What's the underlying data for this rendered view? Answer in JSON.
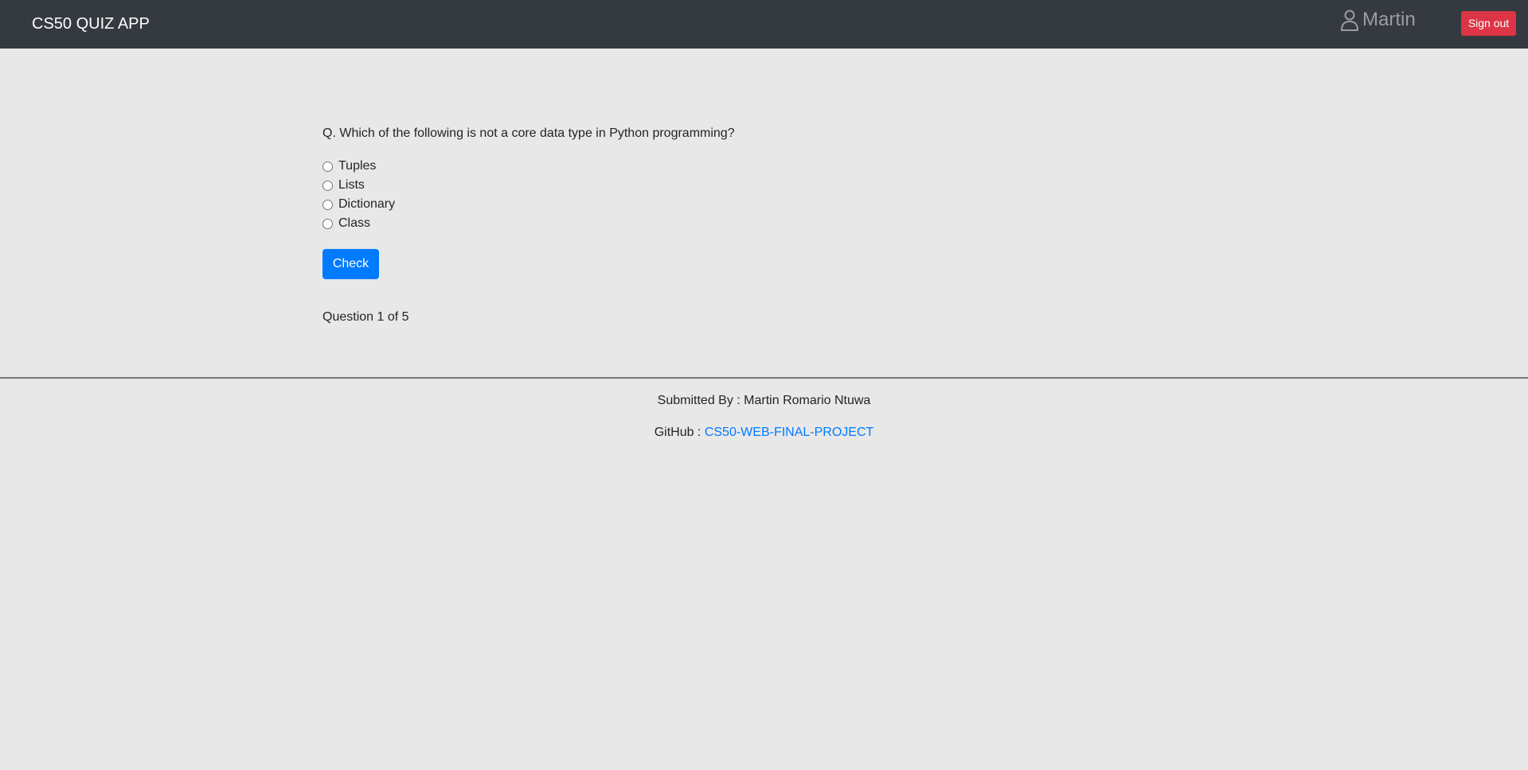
{
  "navbar": {
    "brand": "CS50 QUIZ APP",
    "user_icon": "user-icon",
    "username": "Martin",
    "signout_label": "Sign out"
  },
  "quiz": {
    "question": "Q. Which of the following is not a core data type in Python programming?",
    "options": [
      {
        "label": "Tuples",
        "selected": false
      },
      {
        "label": "Lists",
        "selected": false
      },
      {
        "label": "Dictionary",
        "selected": false
      },
      {
        "label": "Class",
        "selected": false
      }
    ],
    "check_label": "Check",
    "progress": "Question 1 of 5"
  },
  "footer": {
    "submitted": "Submitted By : Martin Romario Ntuwa",
    "github_label": "GitHub : ",
    "github_link": "CS50-WEB-FINAL-PROJECT"
  },
  "colors": {
    "navbar_bg": "#343a40",
    "page_bg": "#e8e8e8",
    "primary": "#007bff",
    "danger": "#dc3545"
  }
}
